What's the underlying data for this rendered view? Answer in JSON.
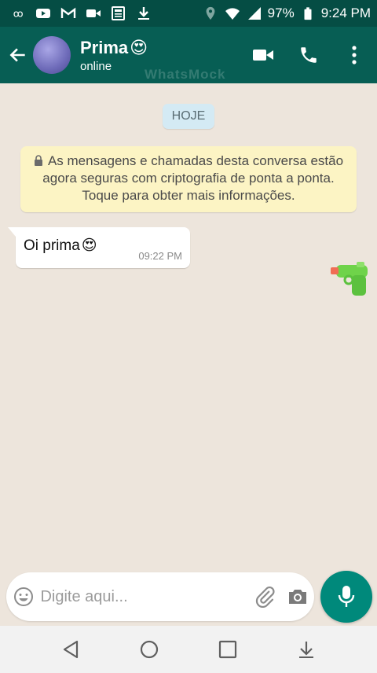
{
  "status_bar": {
    "battery": "97%",
    "time": "9:24 PM",
    "left_icons": [
      "sim-icon",
      "youtube-icon",
      "gmail-icon",
      "video-icon",
      "news-icon",
      "download-icon"
    ],
    "right_icons": [
      "location-icon",
      "wifi-icon",
      "signal-icon",
      "battery-icon"
    ]
  },
  "header": {
    "contact_name": "Prima",
    "contact_emoji": "😍",
    "contact_status": "online",
    "watermark": "WhatsMock",
    "colors": {
      "status_bar": "#054d44",
      "header": "#075e54"
    }
  },
  "chat": {
    "date_chip": "HOJE",
    "security_note": "As mensagens e chamadas desta conversa estão agora seguras com criptografia de ponta a ponta. Toque para obter mais informações.",
    "messages": [
      {
        "text": "Oi prima",
        "emoji": "😍",
        "time": "09:22 PM",
        "direction": "incoming"
      }
    ],
    "sticker": "water-gun-icon"
  },
  "composer": {
    "placeholder": "Digite aqui...",
    "accent": "#00897b"
  },
  "navigation": [
    "back-icon",
    "home-icon",
    "recents-icon",
    "notification-shade-icon"
  ]
}
